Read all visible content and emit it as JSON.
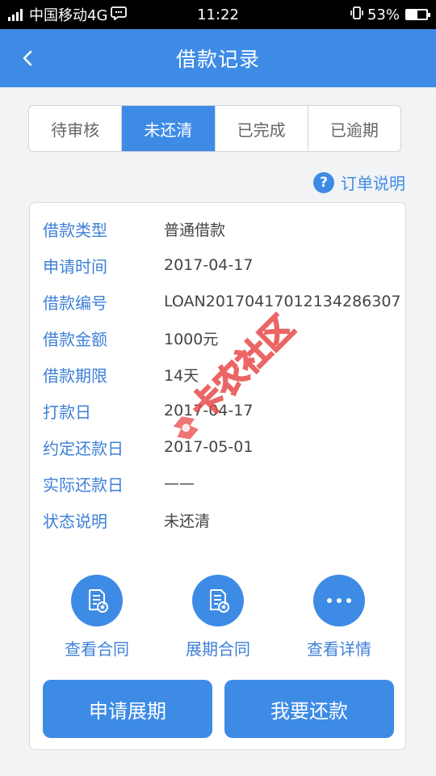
{
  "status_bar": {
    "carrier": "中国移动4G",
    "time": "11:22",
    "battery": "53%",
    "battery_level": 0.53
  },
  "header": {
    "title": "借款记录"
  },
  "tabs": [
    {
      "label": "待审核",
      "active": false
    },
    {
      "label": "未还清",
      "active": true
    },
    {
      "label": "已完成",
      "active": false
    },
    {
      "label": "已逾期",
      "active": false
    }
  ],
  "help": {
    "icon": "?",
    "label": "订单说明"
  },
  "details": [
    {
      "label": "借款类型",
      "value": "普通借款"
    },
    {
      "label": "申请时间",
      "value": "2017-04-17"
    },
    {
      "label": "借款编号",
      "value": "LOAN20170417012134286307"
    },
    {
      "label": "借款金额",
      "value": "1000元"
    },
    {
      "label": "借款期限",
      "value": "14天"
    },
    {
      "label": "打款日",
      "value": "2017-04-17"
    },
    {
      "label": "约定还款日",
      "value": "2017-05-01"
    },
    {
      "label": "实际还款日",
      "value": "——"
    },
    {
      "label": "状态说明",
      "value": "未还清"
    }
  ],
  "actions": [
    {
      "label": "查看合同",
      "icon": "contract-icon"
    },
    {
      "label": "展期合同",
      "icon": "contract-icon"
    },
    {
      "label": "查看详情",
      "icon": "more-icon"
    }
  ],
  "buttons": {
    "extend": "申请展期",
    "repay": "我要还款"
  },
  "watermark": {
    "text": "卡农社区"
  },
  "colors": {
    "primary": "#3e8be6",
    "label": "#3e80d8",
    "watermark": "#e84b4b"
  }
}
